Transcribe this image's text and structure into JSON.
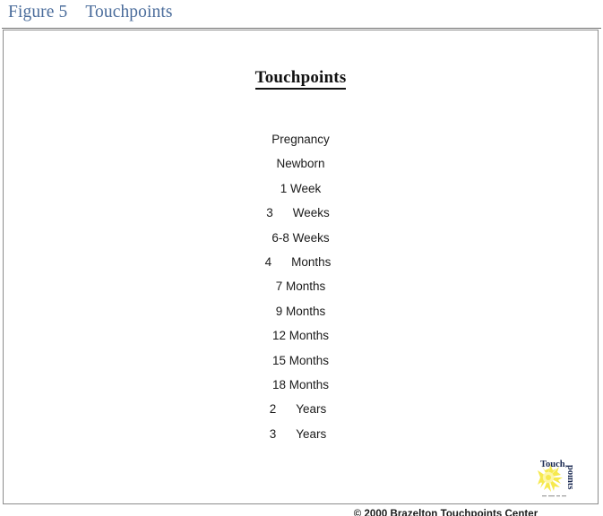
{
  "caption": {
    "label": "Figure 5",
    "title": "Touchpoints"
  },
  "figure": {
    "title": "Touchpoints",
    "touchpoints": [
      {
        "text": "Pregnancy",
        "number": "",
        "unit": "Pregnancy",
        "tabbed": false
      },
      {
        "text": "Newborn",
        "number": "",
        "unit": "Newborn",
        "tabbed": false
      },
      {
        "text": "1 Week",
        "number": "1",
        "unit": "Week",
        "tabbed": false
      },
      {
        "text": "3\tWeeks",
        "number": "3",
        "unit": "Weeks",
        "tabbed": true
      },
      {
        "text": "6-8 Weeks",
        "number": "6-8",
        "unit": "Weeks",
        "tabbed": false
      },
      {
        "text": "4\tMonths",
        "number": "4",
        "unit": "Months",
        "tabbed": true
      },
      {
        "text": "7 Months",
        "number": "7",
        "unit": "Months",
        "tabbed": false
      },
      {
        "text": "9 Months",
        "number": "9",
        "unit": "Months",
        "tabbed": false
      },
      {
        "text": "12 Months",
        "number": "12",
        "unit": "Months",
        "tabbed": false
      },
      {
        "text": "15 Months",
        "number": "15",
        "unit": "Months",
        "tabbed": false
      },
      {
        "text": "18 Months",
        "number": "18",
        "unit": "Months",
        "tabbed": false
      },
      {
        "text": "2\tYears",
        "number": "2",
        "unit": "Years",
        "tabbed": true
      },
      {
        "text": "3\tYears",
        "number": "3",
        "unit": "Years",
        "tabbed": true
      }
    ],
    "logo": {
      "name": "touchpoints-logo",
      "word_top": "Touch",
      "word_side": "points",
      "tagline": "",
      "sun_color": "#f6e94e",
      "sun_color_inner": "#fdf6a8",
      "text_color": "#1b2a52"
    },
    "copyright": "© 2000 Brazelton Touchpoints Center"
  },
  "colors": {
    "caption_blue": "#4a6c9b",
    "frame_gray": "#8c8c8c",
    "rule_gray": "#6f6f6f",
    "text_black": "#1b1b1b",
    "page_background": "#ffffff"
  }
}
